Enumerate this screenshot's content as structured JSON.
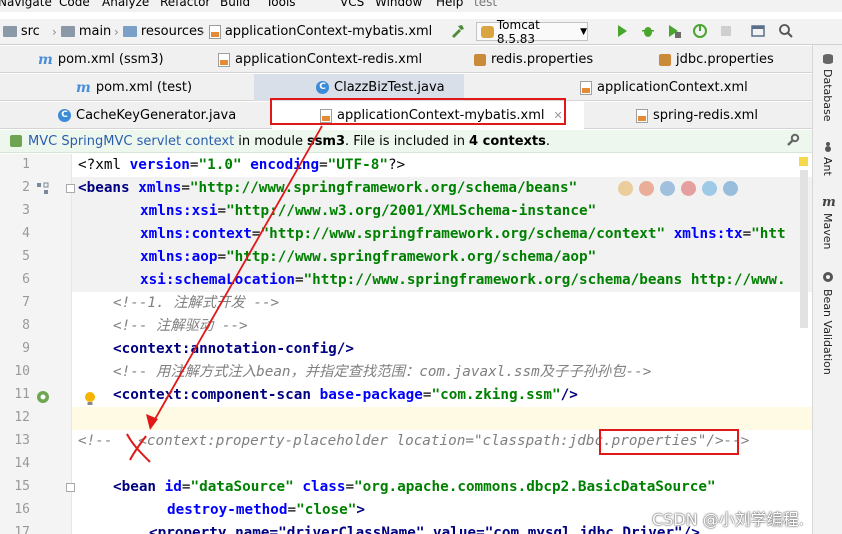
{
  "menu": [
    "Navigate",
    "Code",
    "Analyze",
    "Refactor",
    "Build",
    "Tools",
    "VCS",
    "Window",
    "Help",
    "test"
  ],
  "breadcrumb": [
    "src",
    "main",
    "resources",
    "applicationContext-mybatis.xml"
  ],
  "run_config": "Tomcat 8.5.83",
  "tab_rows": [
    [
      {
        "label": "pom.xml (ssm3)",
        "icon": "maven-icon"
      },
      {
        "label": "applicationContext-redis.xml",
        "icon": "xml-file-icon"
      },
      {
        "label": "redis.properties",
        "icon": "properties-file-icon"
      },
      {
        "label": "jdbc.properties",
        "icon": "properties-file-icon"
      }
    ],
    [
      {
        "label": "pom.xml (test)",
        "icon": "maven-icon"
      },
      {
        "label": "ClazzBizTest.java",
        "icon": "java-class-icon"
      },
      {
        "label": "applicationContext.xml",
        "icon": "xml-file-icon"
      }
    ],
    [
      {
        "label": "CacheKeyGenerator.java",
        "icon": "java-class-icon"
      },
      {
        "label": "applicationContext-mybatis.xml",
        "icon": "xml-file-icon"
      },
      {
        "label": "spring-redis.xml",
        "icon": "xml-file-icon"
      }
    ]
  ],
  "banner": {
    "link": "MVC SpringMVC servlet context",
    "text1": "in module",
    "module": "ssm3",
    "text2": ". File is included in",
    "contexts": "4 contexts",
    "text3": "."
  },
  "right_panel": [
    "Database",
    "Ant",
    "Maven",
    "Bean Validation"
  ],
  "line_numbers": [
    "1",
    "2",
    "3",
    "4",
    "5",
    "6",
    "7",
    "8",
    "9",
    "10",
    "11",
    "12",
    "13",
    "14",
    "15",
    "16",
    "17"
  ],
  "code": {
    "l1": [
      "<?xml ",
      "version",
      "=",
      "\"1.0\"",
      " ",
      "encoding",
      "=",
      "\"UTF-8\"",
      "?>"
    ],
    "l2": [
      "<beans ",
      "xmlns",
      "=",
      "\"http://www.springframework.org/schema/beans\""
    ],
    "l3": [
      "xmlns:xsi",
      "=",
      "\"http://www.w3.org/2001/XMLSchema-instance\""
    ],
    "l4": [
      "xmlns:context",
      "=",
      "\"http://www.springframework.org/schema/context\"",
      " ",
      "xmlns:tx",
      "=",
      "\"htt"
    ],
    "l5": [
      "xmlns:aop",
      "=",
      "\"http://www.springframework.org/schema/aop\""
    ],
    "l6": [
      "xsi:schemaLocation",
      "=",
      "\"http://www.springframework.org/schema/beans http://www."
    ],
    "l7": "<!--1. 注解式开发 -->",
    "l8": "<!-- 注解驱动 -->",
    "l9": [
      "<context:annotation-config",
      "/>"
    ],
    "l10": "<!-- 用注解方式注入bean，并指定查找范围：com.javaxl.ssm及子子孙孙包-->",
    "l11": [
      "<context:component-scan ",
      "base-package",
      "=",
      "\"com.zking.ssm\"",
      "/>"
    ],
    "l13": "<!--   <context:property-placeholder location=\"classpath:jdbc.properties\"/>-->",
    "l15": [
      "<bean ",
      "id",
      "=",
      "\"dataSource\"",
      " ",
      "class",
      "=",
      "\"org.apache.commons.dbcp2.BasicDataSource\""
    ],
    "l16": [
      "destroy-method",
      "=",
      "\"close\"",
      ">"
    ],
    "l17": "<property name=\"driverClassName\" value=\"com.mysql.jdbc.Driver\"/>"
  },
  "watermark": "CSDN @小刘学编程.",
  "colors": {
    "annotation_red": "#e01818",
    "tag": "#000080",
    "attr": "#0000ff",
    "value": "#008000",
    "comment": "#808080"
  }
}
